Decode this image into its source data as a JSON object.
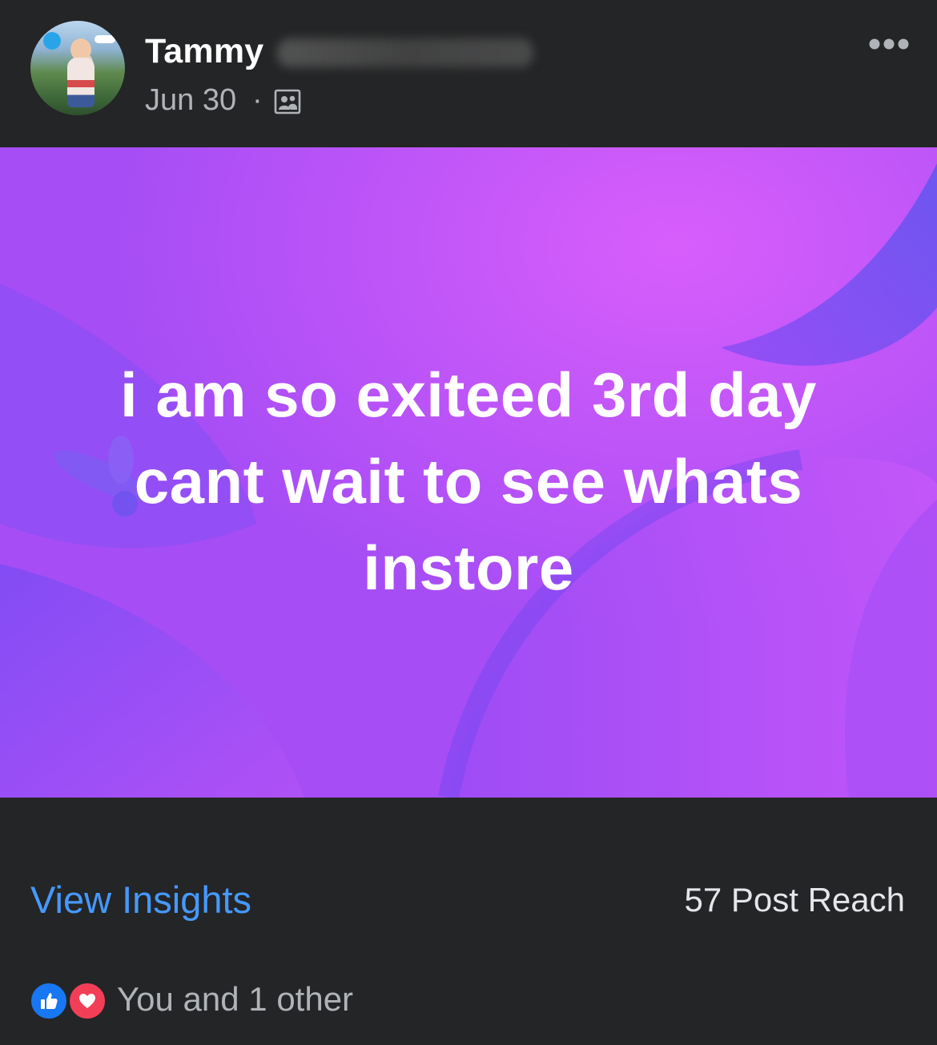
{
  "post": {
    "author_name": "Tammy",
    "date": "Jun 30",
    "date_separator": "·",
    "audience_icon": "friends-icon",
    "more_icon": "more-options-icon",
    "text": "i am so exiteed 3rd day cant wait to see whats instore",
    "background_colors": {
      "base": "#a54df5",
      "light": "#d25cfa",
      "dark": "#6f4df0"
    }
  },
  "footer": {
    "view_insights_label": "View Insights",
    "post_reach": "57 Post Reach",
    "reaction_summary": "You and 1 other",
    "reaction_icons": [
      "like-icon",
      "love-icon"
    ]
  },
  "colors": {
    "background": "#242526",
    "link_blue": "#4599ff",
    "text_primary": "#ffffff",
    "text_secondary": "#b0b3b8",
    "like_blue": "#1877f2",
    "love_red": "#f33e58"
  }
}
